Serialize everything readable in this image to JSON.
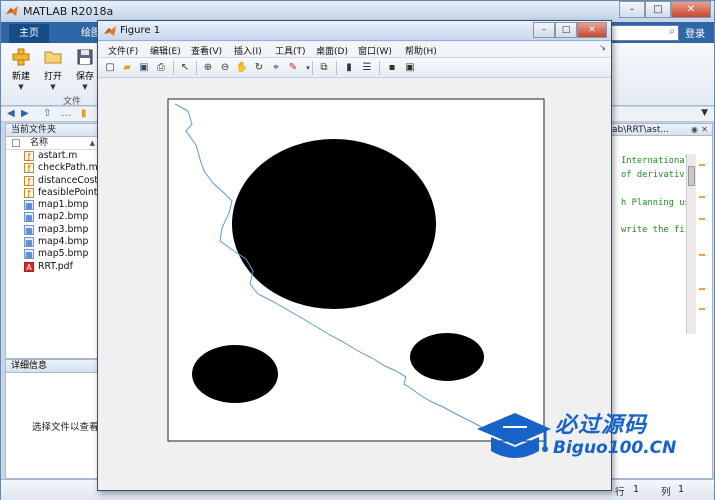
{
  "matlab": {
    "title": "MATLAB R2018a",
    "window_controls": {
      "minimize": "–",
      "maximize": "□",
      "close": "✕"
    },
    "tabs": [
      {
        "label": "主页"
      },
      {
        "label": "绘图"
      }
    ],
    "login_label": "登录",
    "toolstrip": {
      "new_label": "新建",
      "open_label": "打开",
      "save_label": "保存",
      "group_label": "文件",
      "caret": "▼"
    },
    "pathbar": {
      "back": "◀",
      "forward": "▶",
      "up": "⇧",
      "browse": "…",
      "dropdown": "▼"
    },
    "current_folder": {
      "header": "当前文件夹",
      "column_name": "名称",
      "sort_indicator": "▲",
      "files": [
        {
          "name": "astart.m",
          "icon": "m-file-icon"
        },
        {
          "name": "checkPath.m",
          "icon": "m-file-icon"
        },
        {
          "name": "distanceCost.m",
          "icon": "m-file-icon"
        },
        {
          "name": "feasiblePoint.m",
          "icon": "m-file-icon"
        },
        {
          "name": "map1.bmp",
          "icon": "image-file-icon"
        },
        {
          "name": "map2.bmp",
          "icon": "image-file-icon"
        },
        {
          "name": "map3.bmp",
          "icon": "image-file-icon"
        },
        {
          "name": "map4.bmp",
          "icon": "image-file-icon"
        },
        {
          "name": "map5.bmp",
          "icon": "image-file-icon"
        },
        {
          "name": "RRT.pdf",
          "icon": "pdf-file-icon"
        }
      ]
    },
    "details": {
      "header": "详细信息",
      "message": "选择文件以查看详细信息"
    },
    "editor": {
      "path_fragment": "ab\\RRT\\ast...",
      "lines": [
        "International",
        "of derivativ",
        "",
        "h Planning us",
        "",
        "write the fi"
      ]
    },
    "status": {
      "row_label": "行",
      "row_value": "1",
      "col_label": "列",
      "col_value": "1"
    }
  },
  "figure": {
    "title": "Figure 1",
    "menus": [
      {
        "label": "文件(F)"
      },
      {
        "label": "编辑(E)"
      },
      {
        "label": "查看(V)"
      },
      {
        "label": "插入(I)"
      },
      {
        "label": "工具(T)"
      },
      {
        "label": "桌面(D)"
      },
      {
        "label": "窗口(W)"
      },
      {
        "label": "帮助(H)"
      }
    ]
  },
  "plot": {
    "obstacles": [
      {
        "shape": "ellipse",
        "color": "#000000"
      },
      {
        "shape": "ellipse",
        "color": "#000000"
      },
      {
        "shape": "ellipse",
        "color": "#000000"
      }
    ],
    "path_color": "#5b9bd5"
  },
  "watermark": {
    "cn": "必过源码",
    "en": "Biguo100.CN",
    "color": "#1863c9"
  }
}
